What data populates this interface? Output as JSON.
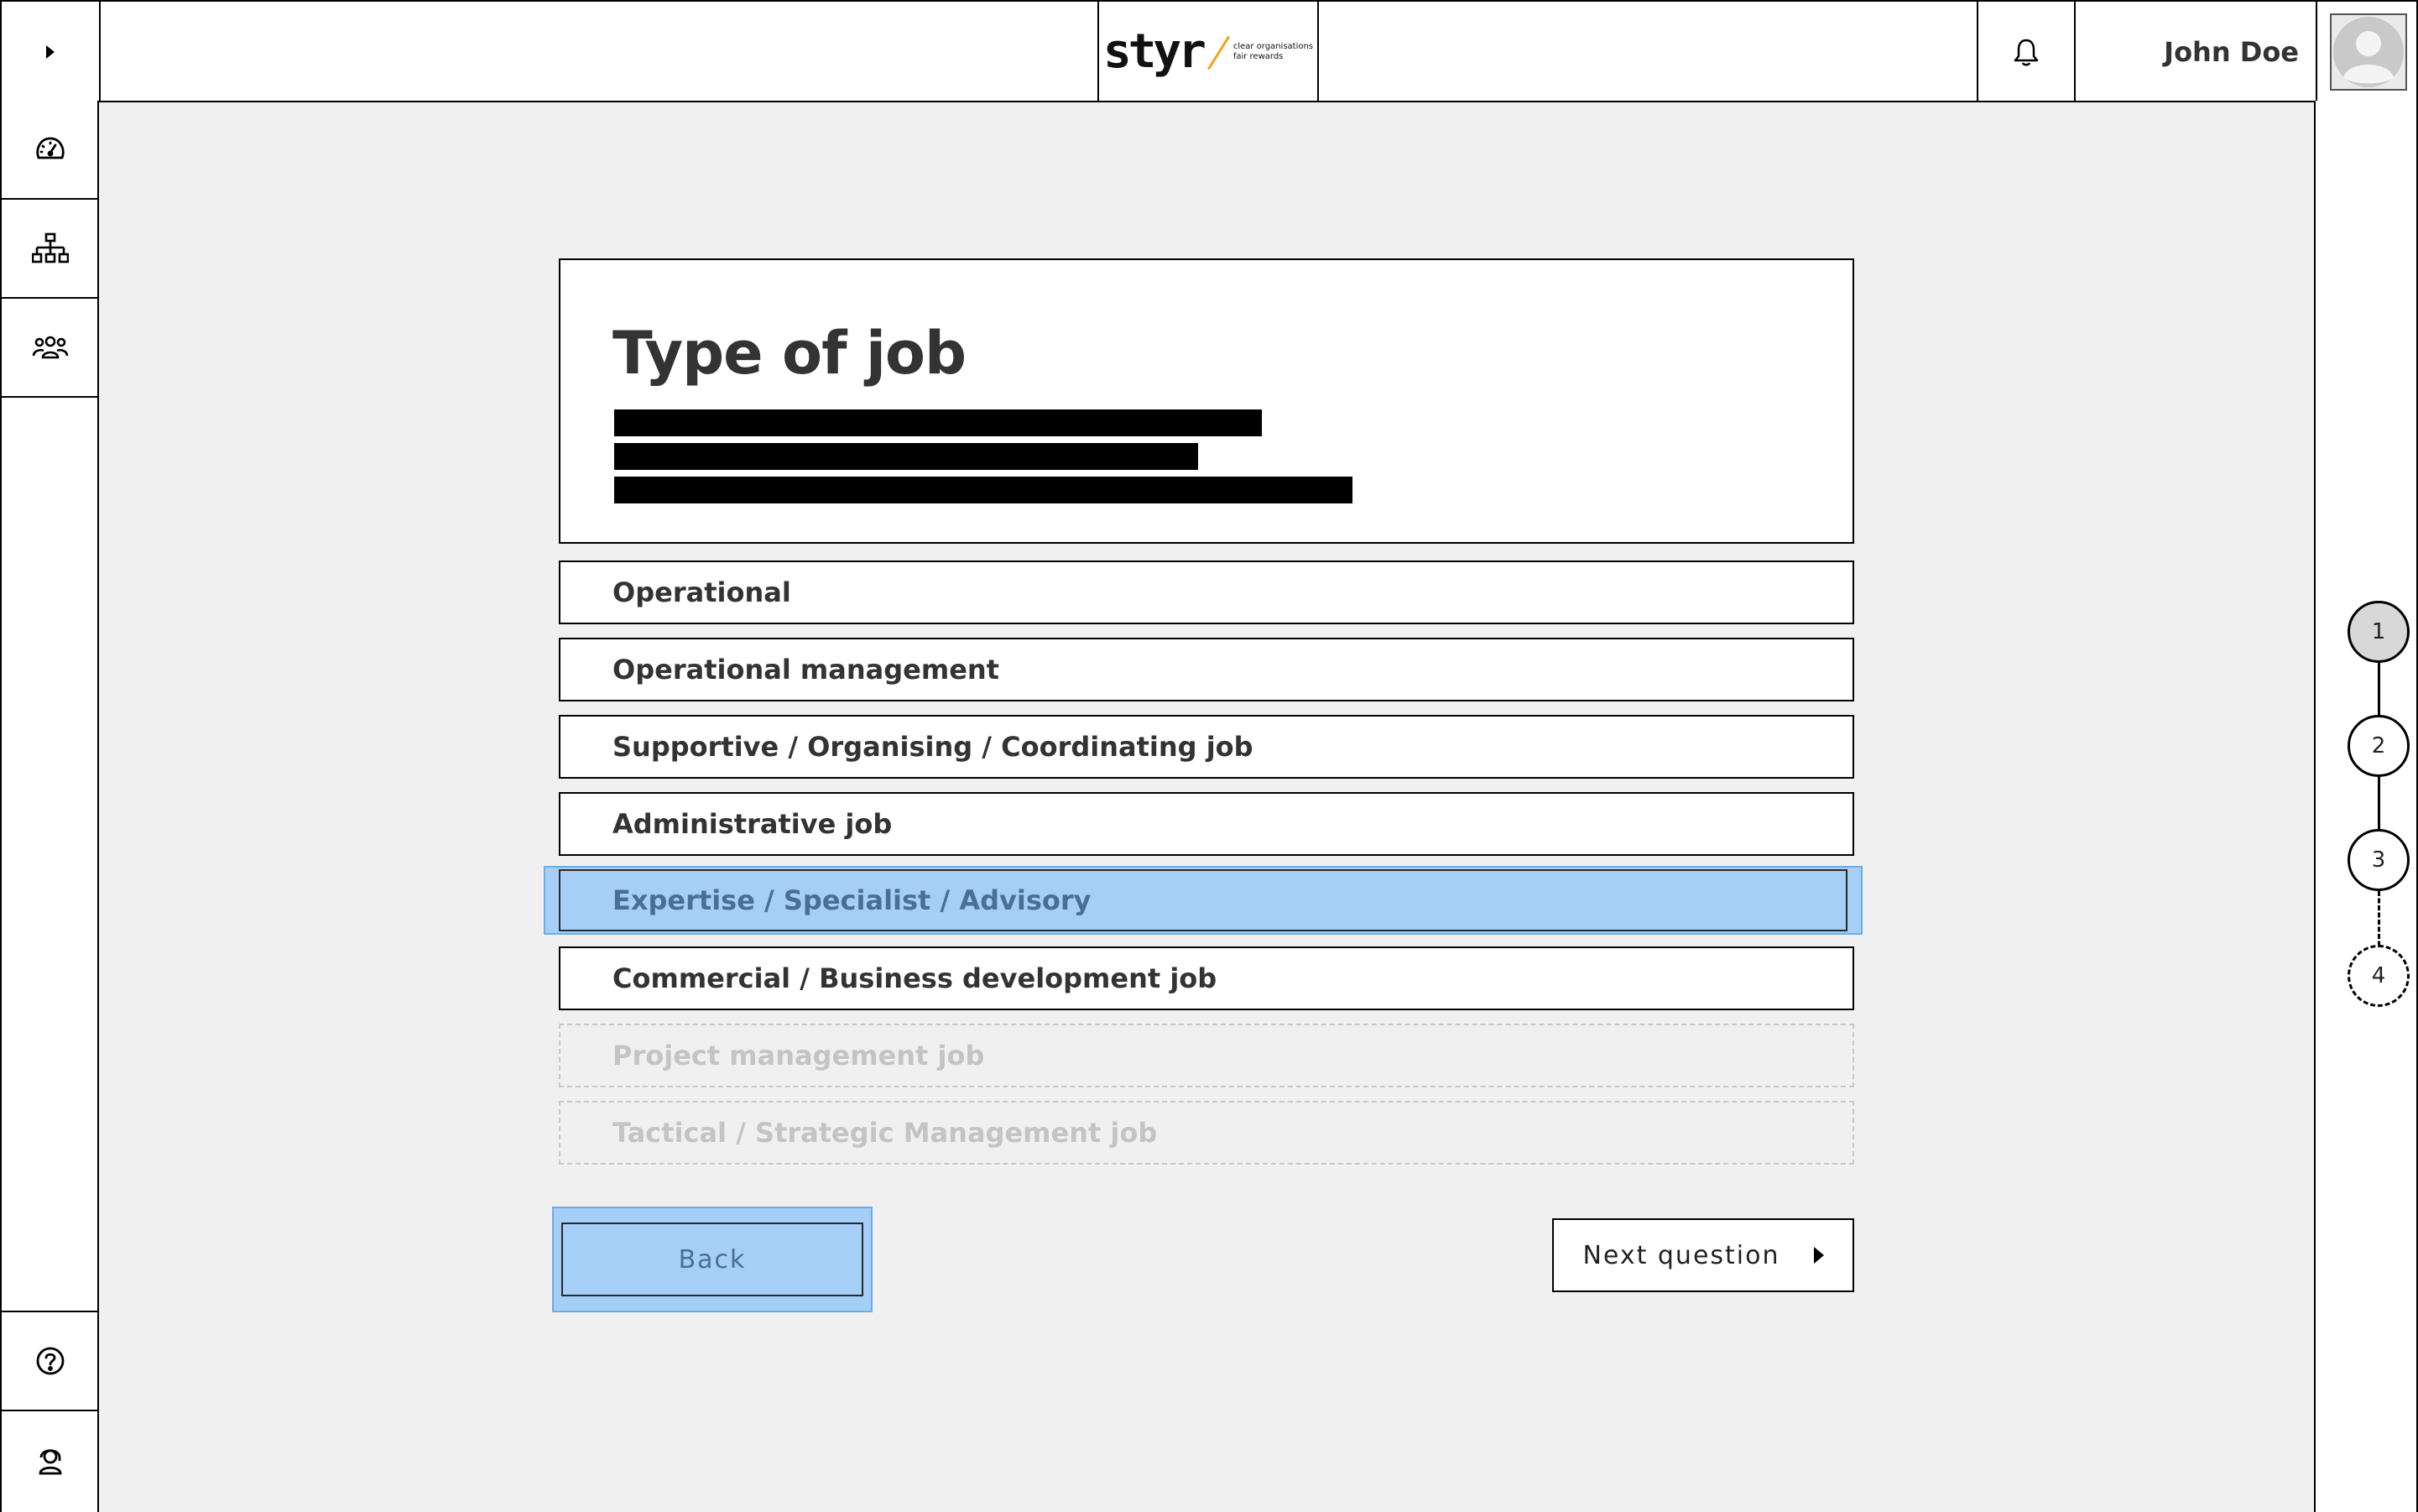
{
  "header": {
    "logo": {
      "word": "styr",
      "tagline_1": "clear organisations",
      "tagline_2": "fair rewards"
    },
    "user_name": "John Doe",
    "icons": {
      "expand": "chevron-right-icon",
      "notifications": "bell-icon",
      "avatar": "user-avatar-icon"
    }
  },
  "sidebar": {
    "items": [
      {
        "icon": "dashboard-gauge-icon"
      },
      {
        "icon": "org-chart-icon"
      },
      {
        "icon": "people-group-icon"
      }
    ],
    "bottom_items": [
      {
        "icon": "help-icon"
      },
      {
        "icon": "support-agent-icon"
      }
    ]
  },
  "question": {
    "title": "Type of job",
    "description_redacted": true
  },
  "options": [
    {
      "label": "Operational",
      "state": "default"
    },
    {
      "label": "Operational management",
      "state": "default"
    },
    {
      "label": "Supportive / Organising / Coordinating job",
      "state": "default"
    },
    {
      "label": "Administrative job",
      "state": "default"
    },
    {
      "label": "Expertise / Specialist / Advisory",
      "state": "selected"
    },
    {
      "label": "Commercial  / Business development job",
      "state": "default"
    },
    {
      "label": "Project management job",
      "state": "disabled"
    },
    {
      "label": "Tactical / Strategic Management job",
      "state": "disabled"
    }
  ],
  "footer": {
    "back_label": "Back",
    "next_label": "Next question"
  },
  "stepper": {
    "steps": [
      {
        "label": "1",
        "state": "active"
      },
      {
        "label": "2",
        "state": "default"
      },
      {
        "label": "3",
        "state": "default"
      },
      {
        "label": "4",
        "state": "pending"
      }
    ]
  },
  "colors": {
    "selected_fill": "#a5cff7",
    "selected_text": "#4a6f95",
    "disabled_text": "#c4c4c4",
    "background": "#f0f0f0",
    "logo_accent": "#f0a31a"
  }
}
